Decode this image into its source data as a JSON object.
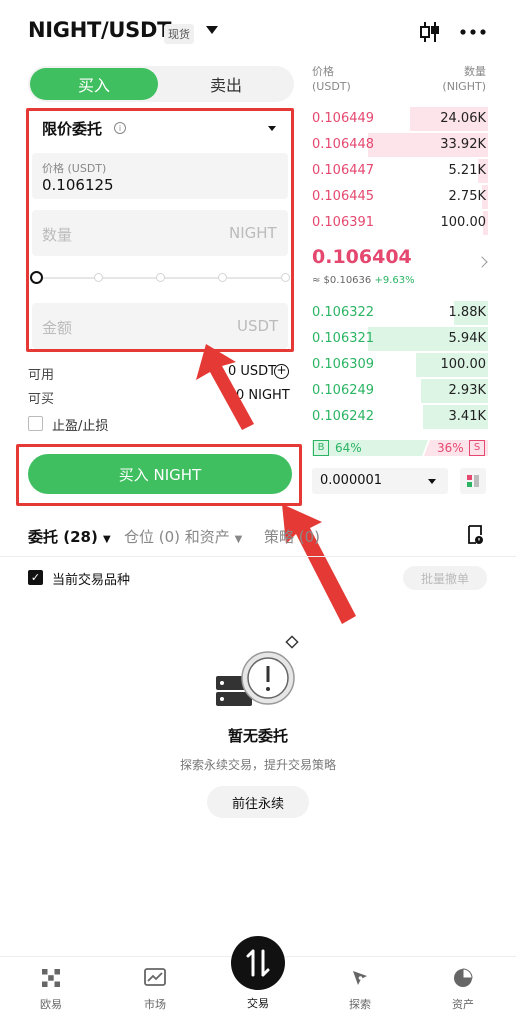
{
  "header": {
    "pair": "NIGHT/USDT",
    "badge": "现货",
    "kline_icon": "candlestick-icon",
    "more_icon": "more-icon"
  },
  "trade": {
    "buy_tab": "买入",
    "sell_tab": "卖出",
    "order_type": "限价委托",
    "price_label": "价格 (USDT)",
    "price_value": "0.106125",
    "qty_placeholder": "数量",
    "qty_unit": "NIGHT",
    "amount_placeholder": "金额",
    "amount_unit": "USDT",
    "available_label": "可用",
    "available_value": "0 USDT",
    "canbuy_label": "可买",
    "canbuy_value": "0 NIGHT",
    "tpsl_label": "止盈/止损",
    "buy_button": "买入 NIGHT"
  },
  "orderbook": {
    "price_header_1": "价格",
    "price_header_2": "(USDT)",
    "qty_header_1": "数量",
    "qty_header_2": "(NIGHT)",
    "asks": [
      {
        "price": "0.106449",
        "qty": "24.06K",
        "depth": 0.65
      },
      {
        "price": "0.106448",
        "qty": "33.92K",
        "depth": 1.0
      },
      {
        "price": "0.106447",
        "qty": "5.21K",
        "depth": 0.08
      },
      {
        "price": "0.106445",
        "qty": "2.75K",
        "depth": 0.05
      },
      {
        "price": "0.106391",
        "qty": "100.00",
        "depth": 0.04
      }
    ],
    "last_price": "0.106404",
    "last_usd": "≈ $0.10636",
    "change": "+9.63%",
    "bids": [
      {
        "price": "0.106322",
        "qty": "1.88K",
        "depth": 0.28
      },
      {
        "price": "0.106321",
        "qty": "5.94K",
        "depth": 1.0
      },
      {
        "price": "0.106309",
        "qty": "100.00",
        "depth": 0.6
      },
      {
        "price": "0.106249",
        "qty": "2.93K",
        "depth": 0.56
      },
      {
        "price": "0.106242",
        "qty": "3.41K",
        "depth": 0.54
      }
    ],
    "buy_tag": "B",
    "buy_pct": "64%",
    "sell_pct": "36%",
    "sell_tag": "S",
    "precision": "0.000001",
    "colors": {
      "ask_bg": "#fde3ea",
      "bid_bg": "#dcf5e5",
      "up": "#2bb463",
      "down": "#e5486f"
    }
  },
  "orders": {
    "tab_orders": "委托 (28)",
    "tab_positions": "仓位 (0) 和资产",
    "tab_strategy": "策略 (0)",
    "current_only_label": "当前交易品种",
    "cancel_all": "批量撤单",
    "empty_title": "暂无委托",
    "empty_sub": "探索永续交易，提升交易策略",
    "go_button": "前往永续"
  },
  "nav": [
    {
      "label": "欧易",
      "icon": "okx-logo-icon"
    },
    {
      "label": "市场",
      "icon": "chart-icon"
    },
    {
      "label": "交易",
      "icon": "trade-swap-icon"
    },
    {
      "label": "探索",
      "icon": "compass-icon"
    },
    {
      "label": "资产",
      "icon": "pie-icon"
    }
  ]
}
